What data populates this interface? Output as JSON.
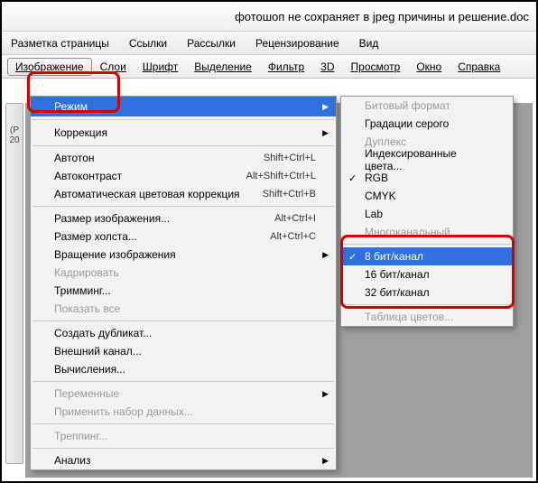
{
  "title": "фотошоп не сохраняет в jpeg причины и решение.doc",
  "topbar": [
    "Разметка страницы",
    "Ссылки",
    "Рассылки",
    "Рецензирование",
    "Вид"
  ],
  "menubar": [
    "Изображение",
    "Слои",
    "Шрифт",
    "Выделение",
    "Фильтр",
    "3D",
    "Просмотр",
    "Окно",
    "Справка"
  ],
  "side": "(Р\n20",
  "m1": {
    "mode": "Режим",
    "corr": "Коррекция",
    "g3": [
      {
        "l": "Автотон",
        "s": "Shift+Ctrl+L"
      },
      {
        "l": "Автоконтраст",
        "s": "Alt+Shift+Ctrl+L"
      },
      {
        "l": "Автоматическая цветовая коррекция",
        "s": "Shift+Ctrl+B"
      }
    ],
    "g4": [
      {
        "l": "Размер изображения...",
        "s": "Alt+Ctrl+I"
      },
      {
        "l": "Размер холста...",
        "s": "Alt+Ctrl+C"
      },
      {
        "l": "Вращение изображения",
        "s": "",
        "sub": true
      },
      {
        "l": "Кадрировать",
        "s": "",
        "dis": true
      },
      {
        "l": "Тримминг...",
        "s": ""
      },
      {
        "l": "Показать все",
        "s": "",
        "dis": true
      }
    ],
    "g5": [
      "Создать дубликат...",
      "Внешний канал...",
      "Вычисления..."
    ],
    "g6": [
      "Переменные",
      "Применить набор данных..."
    ],
    "g7": [
      "Треппинг..."
    ],
    "g8": [
      "Анализ"
    ]
  },
  "m2": {
    "g1": [
      {
        "l": "Битовый формат",
        "dis": true
      },
      {
        "l": "Градации серого"
      },
      {
        "l": "Дуплекс",
        "dis": true
      },
      {
        "l": "Индексированные цвета..."
      },
      {
        "l": "RGB",
        "chk": true
      },
      {
        "l": "CMYK"
      },
      {
        "l": "Lab"
      },
      {
        "l": "Многоканальный",
        "dis": true
      }
    ],
    "g2": [
      {
        "l": "8 бит/канал",
        "chk": true,
        "hl": true
      },
      {
        "l": "16 бит/канал"
      },
      {
        "l": "32 бит/канал"
      }
    ],
    "g3": [
      {
        "l": "Таблица цветов...",
        "dis": true
      }
    ]
  }
}
